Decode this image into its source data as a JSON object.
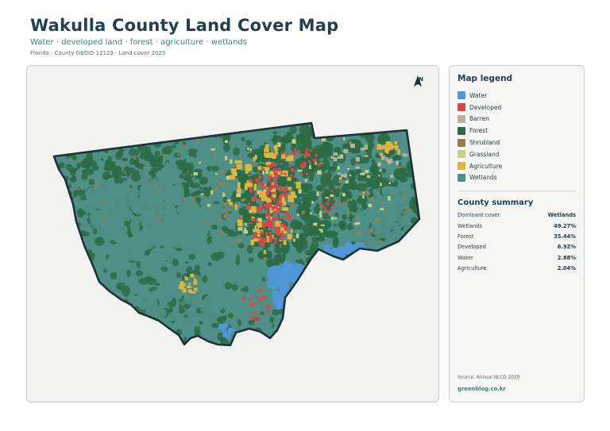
{
  "header": {
    "title": "Wakulla County Land Cover Map",
    "subtitle": "Water · developed land · forest · agriculture · wetlands",
    "meta": "Florida · County GEOID 12129 · Land cover 2025"
  },
  "map": {
    "north_label": "N",
    "north_icon": "north-arrow-icon",
    "colors": {
      "background": "#f2f2f1",
      "boundary": "#1f3138",
      "water": "#4f97d6",
      "developed": "#d9474b",
      "barren": "#b9b29f",
      "forest": "#2b6b45",
      "shrubland": "#9b7c4c",
      "grassland": "#c6cf86",
      "agriculture": "#e2b43b",
      "wetlands": "#4f8f86"
    }
  },
  "legend": {
    "title": "Map legend",
    "items": [
      {
        "label": "Water",
        "color": "#4f97d6"
      },
      {
        "label": "Developed",
        "color": "#d9474b"
      },
      {
        "label": "Barren",
        "color": "#b9b29f"
      },
      {
        "label": "Forest",
        "color": "#2b6b45"
      },
      {
        "label": "Shrubland",
        "color": "#9b7c4c"
      },
      {
        "label": "Grassland",
        "color": "#c6cf86"
      },
      {
        "label": "Agriculture",
        "color": "#e2b43b"
      },
      {
        "label": "Wetlands",
        "color": "#4f8f86"
      }
    ]
  },
  "summary": {
    "title": "County summary",
    "rows": [
      {
        "label": "Dominant cover",
        "value": "Wetlands"
      },
      {
        "label": "Wetlands",
        "value": "49.27%"
      },
      {
        "label": "Forest",
        "value": "35.44%"
      },
      {
        "label": "Developed",
        "value": "6.92%"
      },
      {
        "label": "Water",
        "value": "2.88%"
      },
      {
        "label": "Agriculture",
        "value": "2.04%"
      }
    ]
  },
  "footer": {
    "source": "Source: Annual NLCD 2025",
    "credit": "greenblog.co.kr"
  }
}
